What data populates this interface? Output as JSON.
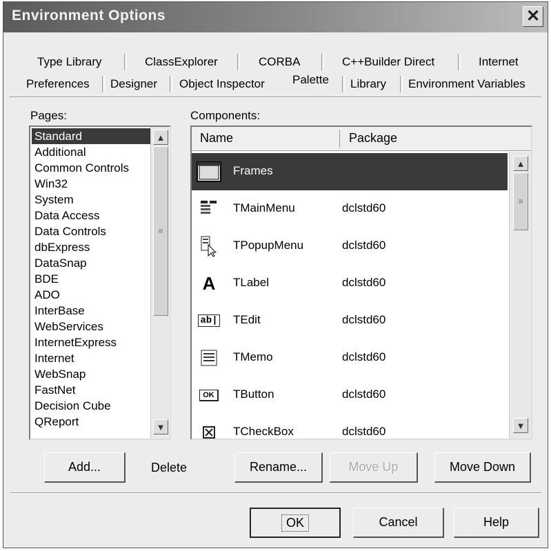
{
  "window": {
    "title": "Environment Options"
  },
  "tabs": {
    "back_row": [
      "Type Library",
      "ClassExplorer",
      "CORBA",
      "C++Builder Direct",
      "Internet"
    ],
    "front_row": [
      "Preferences",
      "Designer",
      "Object Inspector",
      "Palette",
      "Library",
      "Environment Variables"
    ],
    "active": "Palette"
  },
  "pages": {
    "label": "Pages:",
    "items": [
      "Standard",
      "Additional",
      "Common Controls",
      "Win32",
      "System",
      "Data Access",
      "Data Controls",
      "dbExpress",
      "DataSnap",
      "BDE",
      "ADO",
      "InterBase",
      "WebServices",
      "InternetExpress",
      "Internet",
      "WebSnap",
      "FastNet",
      "Decision Cube",
      "QReport"
    ],
    "selected": "Standard"
  },
  "components": {
    "label": "Components:",
    "columns": [
      "Name",
      "Package"
    ],
    "rows": [
      {
        "name": "Frames",
        "package": "",
        "icon": "frames-icon"
      },
      {
        "name": "TMainMenu",
        "package": "dclstd60",
        "icon": "main-menu-icon"
      },
      {
        "name": "TPopupMenu",
        "package": "dclstd60",
        "icon": "popup-menu-icon"
      },
      {
        "name": "TLabel",
        "package": "dclstd60",
        "icon": "label-icon",
        "glyph": "A"
      },
      {
        "name": "TEdit",
        "package": "dclstd60",
        "icon": "edit-icon",
        "glyph": "ab|"
      },
      {
        "name": "TMemo",
        "package": "dclstd60",
        "icon": "memo-icon"
      },
      {
        "name": "TButton",
        "package": "dclstd60",
        "icon": "button-icon",
        "glyph": "OK"
      },
      {
        "name": "TCheckBox",
        "package": "dclstd60",
        "icon": "checkbox-icon"
      }
    ]
  },
  "buttons": {
    "add": "Add...",
    "delete": "Delete",
    "rename": "Rename...",
    "move_up": "Move Up",
    "move_down": "Move Down",
    "ok": "OK",
    "cancel": "Cancel",
    "help": "Help"
  },
  "colors": {
    "selection": "#3a3a3a",
    "face": "#ececec"
  }
}
